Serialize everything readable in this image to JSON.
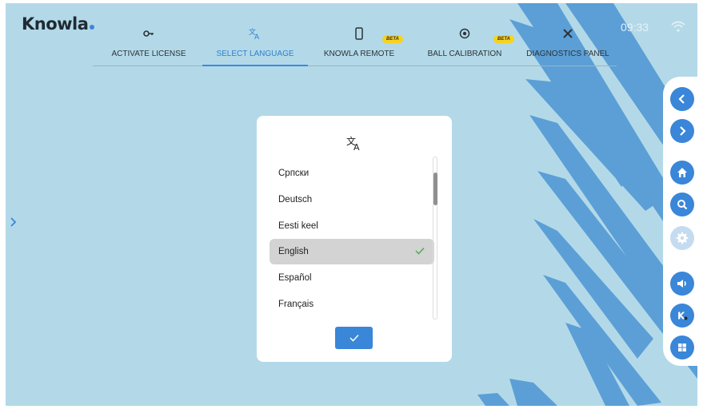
{
  "app": {
    "logo_text": "Knowla"
  },
  "status": {
    "time": "09:33",
    "wifi_icon": "wifi-icon"
  },
  "tabs": [
    {
      "label": "ACTIVATE LICENSE",
      "icon": "key-icon",
      "active": false
    },
    {
      "label": "SELECT LANGUAGE",
      "icon": "translate-icon",
      "active": true
    },
    {
      "label": "KNOWLA REMOTE",
      "icon": "phone-icon",
      "badge": "BETA",
      "active": false
    },
    {
      "label": "BALL CALIBRATION",
      "icon": "target-icon",
      "badge": "BETA",
      "active": false
    },
    {
      "label": "DIAGNOSTICS PANEL",
      "icon": "tools-icon",
      "active": false
    }
  ],
  "dialog": {
    "icon": "translate-icon",
    "languages": [
      "Српски",
      "Deutsch",
      "Eesti keel",
      "English",
      "Español",
      "Français"
    ],
    "selected": "English",
    "confirm_icon": "check-icon"
  },
  "sidebar": {
    "buttons": [
      "back-icon",
      "forward-icon",
      "home-icon",
      "search-icon",
      "settings-icon",
      "volume-icon",
      "knowla-icon",
      "windows-icon"
    ]
  },
  "colors": {
    "background": "#b3d9e8",
    "accent": "#3a86d8",
    "brush": "#5b9fd6",
    "beta_badge": "#f7d21e",
    "selected_row": "#d3d3d3"
  }
}
